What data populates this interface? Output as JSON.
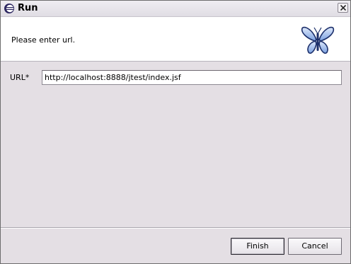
{
  "window": {
    "title": "Run",
    "title_icon": "eclipse-icon",
    "close_icon": "close-icon"
  },
  "banner": {
    "message": "Please enter url.",
    "logo_icon": "butterfly-logo-icon"
  },
  "form": {
    "url_label": "URL*",
    "url_value": "http://localhost:8888/jtest/index.jsf"
  },
  "buttons": {
    "finish": "Finish",
    "cancel": "Cancel"
  },
  "colors": {
    "dialog_bg": "#e4dfe4",
    "banner_bg": "#ffffff",
    "logo_blue": "#4a78c8"
  }
}
